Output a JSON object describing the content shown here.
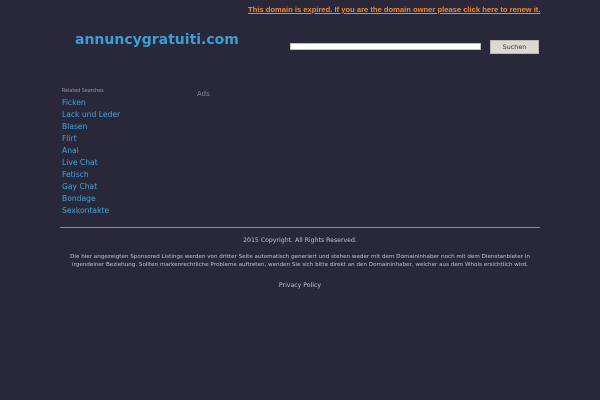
{
  "expired_notice": "This domain is expired. If you are the domain owner please click here to renew it.",
  "domain_name": "annuncygratuiti.com",
  "search": {
    "value": "",
    "placeholder": "",
    "button_label": "Suchen"
  },
  "related": {
    "heading": "Related Searches",
    "items": [
      {
        "label": "Ficken"
      },
      {
        "label": "Lack und Leder"
      },
      {
        "label": "Blasen"
      },
      {
        "label": "Flirt"
      },
      {
        "label": "Anal"
      },
      {
        "label": "Live Chat"
      },
      {
        "label": "Fetisch"
      },
      {
        "label": "Gay Chat"
      },
      {
        "label": "Bondage"
      },
      {
        "label": "Sexkontakte"
      }
    ]
  },
  "ads_label": "Ads",
  "footer": {
    "copyright": "2015 Copyright. All Rights Reserved.",
    "disclaimer": "Die hier angezeigten Sponsored Listings werden von dritter Seite automatisch generiert und stehen weder mit dem Domaininhaber noch mit dem Dienstanbieter in irgendeiner Beziehung. Sollten markenrechtliche Probleme auftreten, wenden Sie sich bitte direkt an den Domaininhaber, welcher aus dem Whois ersichtlich wird.",
    "privacy_label": "Privacy Policy"
  },
  "colors": {
    "background": "#28283a",
    "domain_title": "#3b9fd6",
    "links": "#41a6dc",
    "expired_notice": "#f08a2c"
  }
}
